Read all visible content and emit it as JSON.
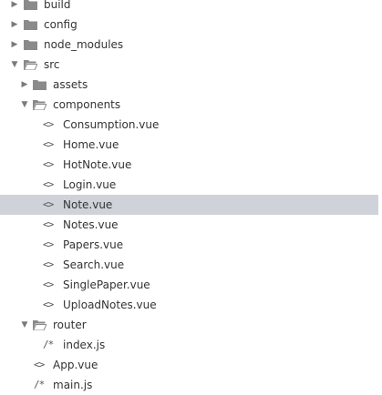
{
  "explorer": {
    "build": "build",
    "config": "config",
    "node_modules": "node_modules",
    "src": "src",
    "assets": "assets",
    "components": "components",
    "components_files": [
      "Consumption.vue",
      "Home.vue",
      "HotNote.vue",
      "Login.vue",
      "Note.vue",
      "Notes.vue",
      "Papers.vue",
      "Search.vue",
      "SinglePaper.vue",
      "UploadNotes.vue"
    ],
    "router": "router",
    "router_index": "index.js",
    "app": "App.vue",
    "main": "main.js",
    "selected": "Note.vue"
  },
  "glyphs": {
    "collapsed": "▶",
    "expanded": "▼",
    "vue_file": "<>",
    "js_file": "/*"
  },
  "colors": {
    "selection": "#cfd3d9",
    "folder": "#8a8a8a",
    "text": "#333333"
  }
}
